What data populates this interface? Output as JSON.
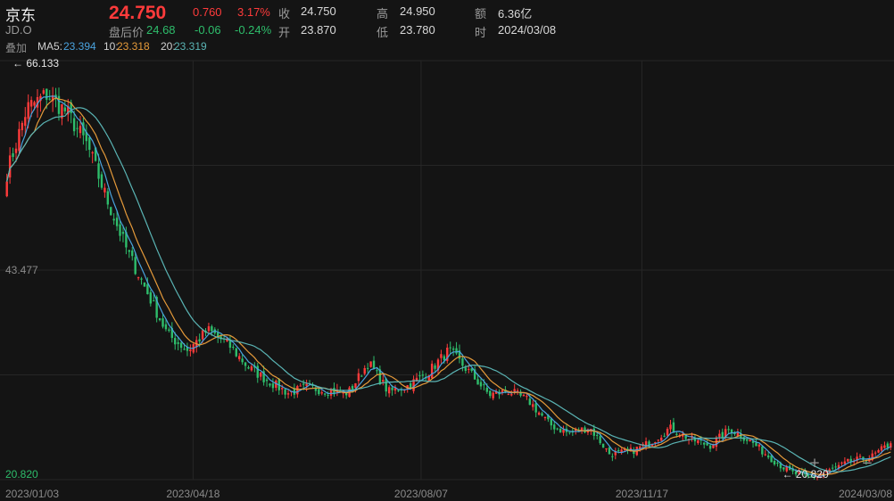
{
  "header": {
    "name": "京东",
    "code": "JD.O",
    "last_price": "24.750",
    "change": "0.760",
    "change_pct": "3.17%",
    "after_hours_label": "盘后价",
    "after_hours_price": "24.68",
    "after_hours_change": "-0.06",
    "after_hours_pct": "-0.24%",
    "close_label": "收",
    "close_value": "24.750",
    "open_label": "开",
    "open_value": "23.870",
    "high_label": "高",
    "high_value": "24.950",
    "low_label": "低",
    "low_value": "23.780",
    "amount_label": "额",
    "amount_value": "6.36亿",
    "time_label": "时",
    "time_value": "2024/03/08"
  },
  "indicators": {
    "overlay_label": "叠加",
    "ma5_label": "MA5:",
    "ma5_value": "23.394",
    "ma10_label": "10:",
    "ma10_value": "23.318",
    "ma20_label": "20:",
    "ma20_value": "23.319"
  },
  "colors": {
    "up": "#ff3b3b",
    "down": "#2ebd6b",
    "ma5": "#4aa3df",
    "ma10": "#e59a3a",
    "ma20": "#5ab4b4",
    "background": "#141414",
    "grid": "#262626"
  },
  "chart_data": {
    "type": "candlestick",
    "title": "",
    "xlabel": "",
    "ylabel": "",
    "ylim": [
      20.82,
      66.133
    ],
    "y_ticks": [
      "43.477",
      "20.820"
    ],
    "x_tick_labels": [
      "2023/01/03",
      "2023/04/18",
      "2023/08/07",
      "2023/11/17",
      "2024/03/08"
    ],
    "annotations": {
      "max_label": "66.133",
      "min_label": "20.820"
    },
    "grid": true,
    "controls": {
      "zoom_in": "+",
      "zoom_out": "−"
    },
    "close_series": {
      "dates": [
        "2023/01/03",
        "2023/01/10",
        "2023/01/20",
        "2023/02/01",
        "2023/02/10",
        "2023/02/22",
        "2023/03/03",
        "2023/03/13",
        "2023/03/22",
        "2023/03/31",
        "2023/04/11",
        "2023/04/18",
        "2023/04/27",
        "2023/05/05",
        "2023/05/15",
        "2023/05/25",
        "2023/06/06",
        "2023/06/15",
        "2023/06/27",
        "2023/07/07",
        "2023/07/18",
        "2023/07/27",
        "2023/08/07",
        "2023/08/15",
        "2023/08/24",
        "2023/09/01",
        "2023/09/12",
        "2023/09/21",
        "2023/10/02",
        "2023/10/11",
        "2023/10/19",
        "2023/10/30",
        "2023/11/08",
        "2023/11/17",
        "2023/11/28",
        "2023/12/07",
        "2023/12/18",
        "2023/12/28",
        "2024/01/09",
        "2024/01/19",
        "2024/01/31",
        "2024/02/08",
        "2024/02/20",
        "2024/02/29",
        "2024/03/08"
      ],
      "values": [
        54.0,
        61.0,
        62.5,
        60.5,
        57.0,
        51.0,
        45.5,
        41.0,
        36.5,
        34.8,
        37.0,
        35.5,
        33.0,
        31.5,
        30.2,
        30.8,
        30.4,
        30.2,
        33.5,
        30.3,
        31.0,
        32.5,
        34.8,
        32.5,
        30.0,
        30.4,
        29.3,
        26.8,
        25.8,
        26.5,
        23.6,
        23.8,
        24.8,
        26.4,
        25.2,
        24.5,
        26.3,
        25.0,
        23.2,
        21.6,
        21.0,
        21.8,
        22.8,
        23.2,
        24.75
      ]
    }
  }
}
